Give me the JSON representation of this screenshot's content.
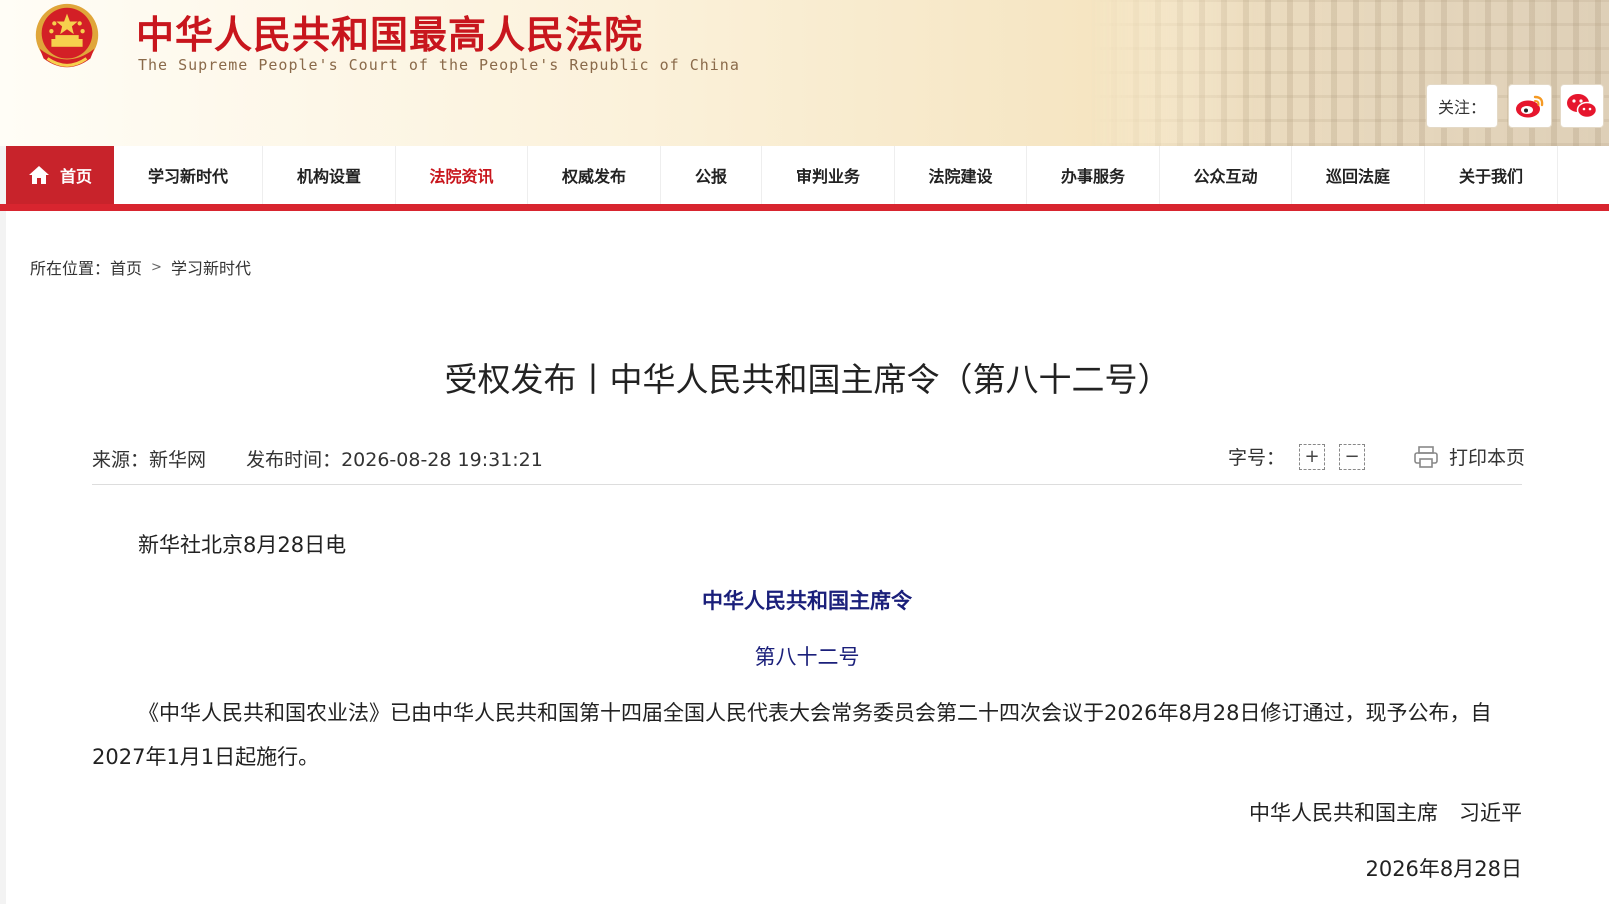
{
  "header": {
    "title_cn": "中华人民共和国最高人民法院",
    "title_en": "The Supreme People's Court of the People's Republic of China",
    "follow_label": "关注：",
    "social": [
      {
        "name": "weibo",
        "icon": "weibo-icon"
      },
      {
        "name": "wechat",
        "icon": "wechat-icon"
      }
    ]
  },
  "nav": {
    "items": [
      {
        "label": "首页",
        "icon": "home-icon",
        "active": true
      },
      {
        "label": "学习新时代"
      },
      {
        "label": "机构设置"
      },
      {
        "label": "法院资讯",
        "current": true
      },
      {
        "label": "权威发布"
      },
      {
        "label": "公报"
      },
      {
        "label": "审判业务"
      },
      {
        "label": "法院建设"
      },
      {
        "label": "办事服务"
      },
      {
        "label": "公众互动"
      },
      {
        "label": "巡回法庭"
      },
      {
        "label": "关于我们"
      }
    ]
  },
  "breadcrumb": {
    "prefix": "所在位置：",
    "items": [
      "首页",
      "学习新时代"
    ],
    "separator": ">"
  },
  "article": {
    "title": "受权发布丨中华人民共和国主席令（第八十二号）",
    "source": "来源：新华网",
    "published": "发布时间：2026-08-28 19:31:21",
    "font_size_label": "字号：",
    "font_increase": "+",
    "font_decrease": "−",
    "print_label": "打印本页",
    "lead": "新华社北京8月28日电",
    "heading": "中华人民共和国主席令",
    "number": "第八十二号",
    "paragraph": "《中华人民共和国农业法》已由中华人民共和国第十四届全国人民代表大会常务委员会第二十四次会议于2026年8月28日修订通过，现予公布，自2027年1月1日起施行。",
    "signature": "中华人民共和国主席　习近平",
    "date": "2026年8月28日"
  },
  "colors": {
    "brand_red": "#c8161d",
    "nav_bar_red": "#d8252f",
    "heading_navy": "#1a1f7a"
  }
}
